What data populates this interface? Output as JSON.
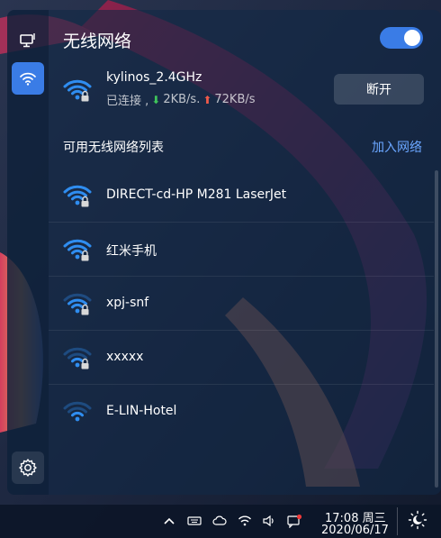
{
  "panel": {
    "title": "无线网络",
    "wifi_enabled": true
  },
  "sidebar": {
    "items": [
      {
        "icon": "wired-network-icon"
      },
      {
        "icon": "wifi-icon",
        "active": true
      }
    ],
    "settings_icon": "gear-icon"
  },
  "current": {
    "ssid": "kylinos_2.4GHz",
    "status_prefix": "已连接 ,",
    "download": "2KB/s.",
    "upload": "72KB/s",
    "disconnect_label": "断开"
  },
  "list": {
    "title": "可用无线网络列表",
    "join_label": "加入网络",
    "networks": [
      {
        "ssid": "DIRECT-cd-HP M281 LaserJet",
        "locked": true,
        "signal": 4
      },
      {
        "ssid": "红米手机",
        "locked": true,
        "signal": 4
      },
      {
        "ssid": "xpj-snf",
        "locked": true,
        "signal": 3
      },
      {
        "ssid": "xxxxx",
        "locked": true,
        "signal": 2
      },
      {
        "ssid": "E-LIN-Hotel",
        "locked": false,
        "signal": 2
      }
    ]
  },
  "taskbar": {
    "time": "17:08 周三",
    "date": "2020/06/17",
    "tray_icons": [
      "chevron-up-icon",
      "keyboard-icon",
      "cloud-icon",
      "wifi-icon",
      "volume-icon",
      "notification-icon",
      "night-mode-icon"
    ]
  },
  "colors": {
    "accent": "#3a7ce6",
    "link": "#6aa6ff",
    "download_arrow": "#3fc55b",
    "upload_arrow": "#ef5a4a"
  }
}
